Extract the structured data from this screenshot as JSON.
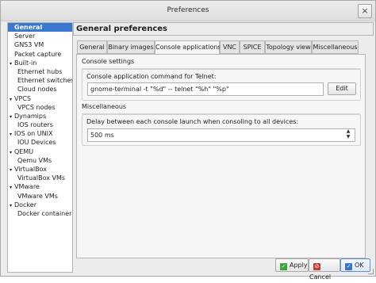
{
  "window": {
    "title": "Preferences",
    "close_glyph": "×"
  },
  "sidebar": {
    "items": [
      {
        "label": "General",
        "level": "top",
        "selected": true
      },
      {
        "label": "Server",
        "level": "top"
      },
      {
        "label": "GNS3 VM",
        "level": "top"
      },
      {
        "label": "Packet capture",
        "level": "top"
      },
      {
        "label": "Built-in",
        "level": "parent"
      },
      {
        "label": "Ethernet hubs",
        "level": "child"
      },
      {
        "label": "Ethernet switches",
        "level": "child"
      },
      {
        "label": "Cloud nodes",
        "level": "child"
      },
      {
        "label": "VPCS",
        "level": "parent"
      },
      {
        "label": "VPCS nodes",
        "level": "child"
      },
      {
        "label": "Dynamips",
        "level": "parent"
      },
      {
        "label": "IOS routers",
        "level": "child"
      },
      {
        "label": "IOS on UNIX",
        "level": "parent"
      },
      {
        "label": "IOU Devices",
        "level": "child"
      },
      {
        "label": "QEMU",
        "level": "parent"
      },
      {
        "label": "Qemu VMs",
        "level": "child"
      },
      {
        "label": "VirtualBox",
        "level": "parent"
      },
      {
        "label": "VirtualBox VMs",
        "level": "child"
      },
      {
        "label": "VMware",
        "level": "parent"
      },
      {
        "label": "VMware VMs",
        "level": "child"
      },
      {
        "label": "Docker",
        "level": "parent"
      },
      {
        "label": "Docker containers",
        "level": "child"
      }
    ]
  },
  "main": {
    "title": "General preferences",
    "tabs": [
      {
        "label": "General"
      },
      {
        "label": "Binary images"
      },
      {
        "label": "Console applications",
        "active": true
      },
      {
        "label": "VNC"
      },
      {
        "label": "SPICE"
      },
      {
        "label": "Topology view"
      },
      {
        "label": "Miscellaneous"
      }
    ],
    "console_settings": {
      "section_label": "Console settings",
      "telnet_label": "Console application command for Telnet:",
      "telnet_value": "gnome-terminal -t \"%d\" -- telnet \"%h\" \"%p\"",
      "edit_label": "Edit"
    },
    "misc": {
      "section_label": "Miscellaneous",
      "delay_label": "Delay between each console launch when consoling to all devices:",
      "delay_value": "500 ms"
    }
  },
  "footer": {
    "apply_label": "Apply",
    "cancel_label": "Cancel",
    "ok_label": "OK"
  },
  "colors": {
    "selection": "#3b78d0",
    "apply_icon": "#3aa33a",
    "cancel_icon": "#c83a3a",
    "ok_icon": "#3a74c8"
  }
}
